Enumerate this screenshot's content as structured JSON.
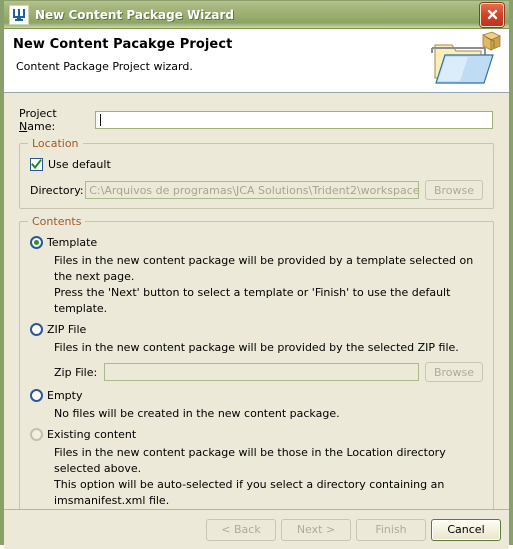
{
  "window": {
    "title": "New Content Package Wizard",
    "app_icon": "trident-w-icon",
    "close_label": "close-icon"
  },
  "header": {
    "title": "New Content Pacakge Project",
    "description": "Content Package Project wizard.",
    "icon": "open-folder-package-icon"
  },
  "project": {
    "name_label": "Project Name:",
    "name_value": "",
    "name_placeholder": ""
  },
  "location": {
    "group_title": "Location",
    "use_default_label": "Use default",
    "use_default_checked": true,
    "directory_label": "Directory:",
    "directory_value": "C:\\Arquivos de programas\\JCA Solutions\\Trident2\\workspace",
    "browse_label": "Browse"
  },
  "contents": {
    "group_title": "Contents",
    "options": [
      {
        "id": "template",
        "label": "Template",
        "selected": true,
        "disabled": false,
        "descriptions": [
          "Files in the new content package will be provided by a template selected on the next page.",
          "Press the 'Next' button to select a template or 'Finish' to use the default template."
        ]
      },
      {
        "id": "zip-file",
        "label": "ZIP File",
        "selected": false,
        "disabled": false,
        "descriptions": [
          "Files in the new content package will be provided by the selected ZIP file."
        ]
      },
      {
        "id": "empty",
        "label": "Empty",
        "selected": false,
        "disabled": false,
        "descriptions": [
          "No files will be created in the new content package."
        ]
      },
      {
        "id": "existing-content",
        "label": "Existing content",
        "selected": false,
        "disabled": true,
        "descriptions": [
          "Files in the new content package will be those in the Location directory selected above.",
          "This option will be auto-selected if you select a directory containing an imsmanifest.xml file."
        ]
      }
    ],
    "zip_file_label": "Zip File:",
    "zip_file_value": "",
    "zip_browse_label": "Browse"
  },
  "footer": {
    "back_label": "< Back",
    "next_label": "Next >",
    "finish_label": "Finish",
    "cancel_label": "Cancel",
    "back_enabled": false,
    "next_enabled": false,
    "finish_enabled": false,
    "cancel_enabled": true
  },
  "colors": {
    "titlebar": "#9aae6f",
    "window_border": "#8aa06a",
    "background": "#ece9d8",
    "group_label": "#a4572a",
    "accent_blue": "#2b5797",
    "check_green": "#2f8f2f",
    "close_red": "#d1452a"
  }
}
